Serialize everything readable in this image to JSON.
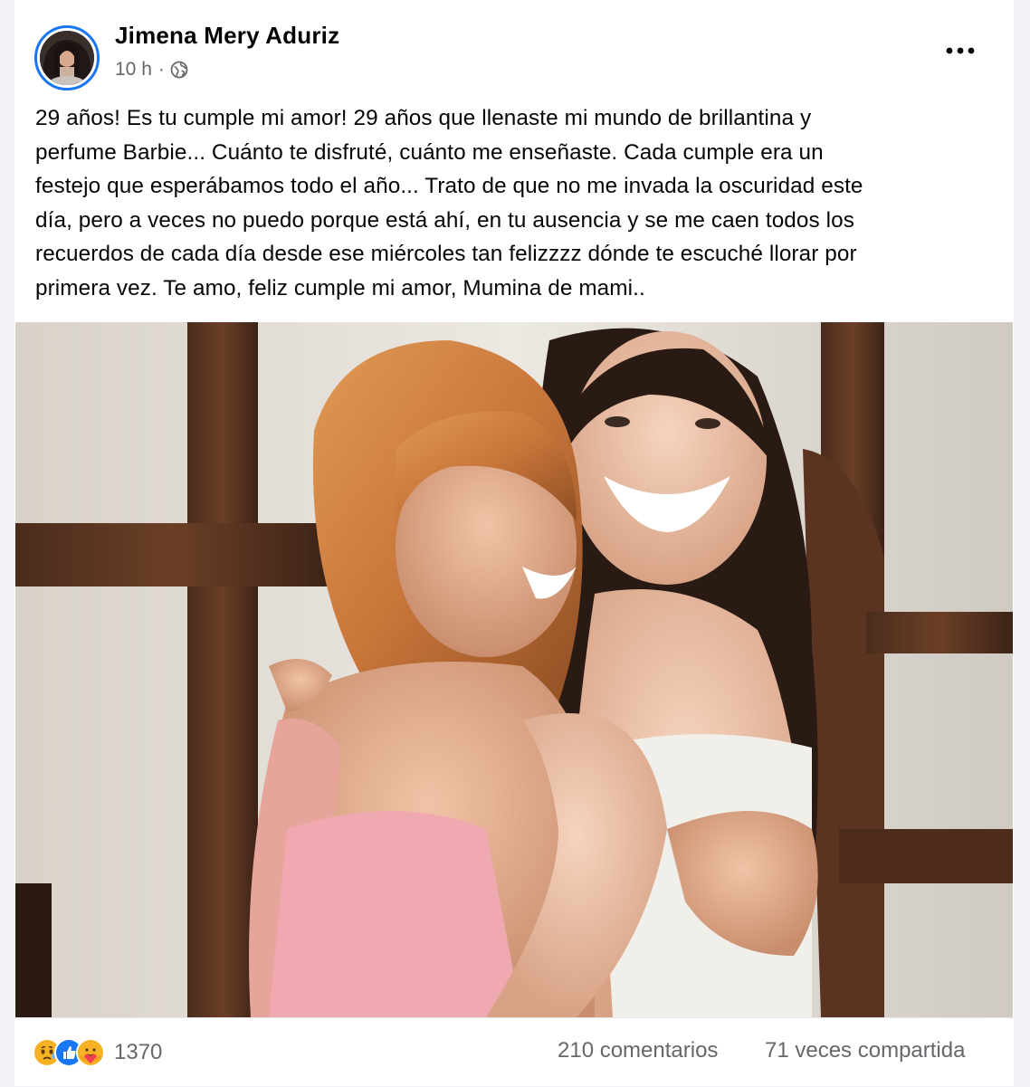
{
  "post": {
    "author": "Jimena Mery Aduriz",
    "time": "10 h",
    "separator": "·",
    "audience_icon": "globe-icon",
    "more_icon": "more-options-icon",
    "text_lines": [
      "29 años! Es tu cumple mi amor! 29 años que llenaste mi mundo de brillantina y",
      "perfume Barbie... Cuánto te disfruté, cuánto me enseñaste. Cada cumple era un",
      "festejo que esperábamos todo el año... Trato de que no me invada la oscuridad este",
      "día, pero a veces no puedo porque está ahí, en tu ausencia y se me caen todos los",
      "recuerdos de cada día desde ese miércoles tan felizzzz dónde te escuché llorar por",
      "primera vez. Te amo, feliz cumple mi amor, Mumina de mami.."
    ]
  },
  "footer": {
    "reaction_icons": [
      "sad-reaction-icon",
      "like-reaction-icon",
      "care-reaction-icon"
    ],
    "reaction_count": "1370",
    "comments": "210 comentarios",
    "shares": "71 veces compartida"
  },
  "colors": {
    "accent": "#1877f2",
    "secondary_text": "#65676b",
    "primary_text": "#050505",
    "sad_reaction": "#f7b125",
    "like_reaction": "#1877f2",
    "care_reaction": "#f33e58"
  }
}
